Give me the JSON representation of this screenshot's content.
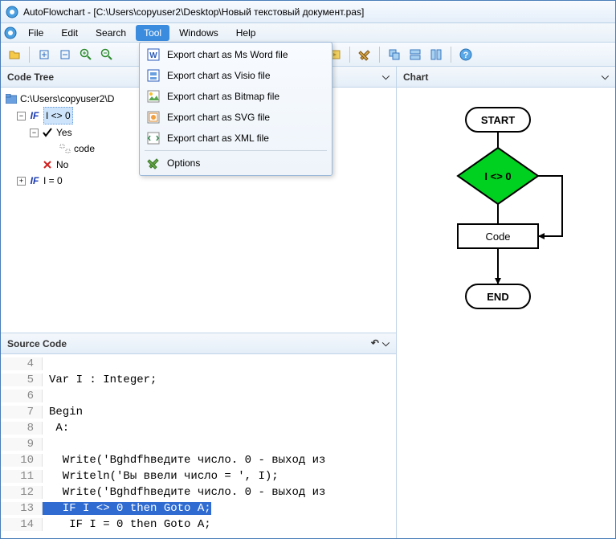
{
  "title": "AutoFlowchart - [C:\\Users\\copyuser2\\Desktop\\Новый текстовый документ.pas]",
  "menu": {
    "file": "File",
    "edit": "Edit",
    "search": "Search",
    "tool": "Tool",
    "windows": "Windows",
    "help": "Help"
  },
  "dropdown": {
    "word": "Export chart as Ms Word file",
    "visio": "Export chart as Visio file",
    "bitmap": "Export chart as Bitmap file",
    "svg": "Export chart as SVG file",
    "xml": "Export chart as XML file",
    "options": "Options"
  },
  "panels": {
    "codetree": "Code Tree",
    "sourcecode": "Source Code",
    "chart": "Chart"
  },
  "tree": {
    "root": "C:\\Users\\copyuser2\\D",
    "if1": "I <> 0",
    "yes": "Yes",
    "code": "code",
    "no": "No",
    "if2": "I = 0"
  },
  "source": {
    "l4": "",
    "l5": "Var I : Integer;",
    "l6": "",
    "l7": "Begin",
    "l8": " A:",
    "l9": "",
    "l10": "  Write('Bghdfhведите число. 0 - выход из",
    "l11": "  Writeln('Вы ввели число = ', I);",
    "l12": "  Write('Bghdfhведите число. 0 - выход из",
    "l13": "  IF I <> 0 then Goto A;",
    "l14": "   IF I = 0 then Goto A;"
  },
  "ln": {
    "l4": "4",
    "l5": "5",
    "l6": "6",
    "l7": "7",
    "l8": "8",
    "l9": "9",
    "l10": "10",
    "l11": "11",
    "l12": "12",
    "l13": "13",
    "l14": "14"
  },
  "flow": {
    "start": "START",
    "cond": "I <> 0",
    "code": "Code",
    "end": "END"
  },
  "chart_data": {
    "type": "flowchart",
    "nodes": [
      {
        "id": "start",
        "type": "terminator",
        "label": "START"
      },
      {
        "id": "cond",
        "type": "decision",
        "label": "I <> 0"
      },
      {
        "id": "code",
        "type": "process",
        "label": "Code"
      },
      {
        "id": "end",
        "type": "terminator",
        "label": "END"
      }
    ],
    "edges": [
      {
        "from": "start",
        "to": "cond"
      },
      {
        "from": "cond",
        "to": "code",
        "label": ""
      },
      {
        "from": "cond",
        "to": "code",
        "via": "right"
      },
      {
        "from": "code",
        "to": "end"
      }
    ]
  }
}
